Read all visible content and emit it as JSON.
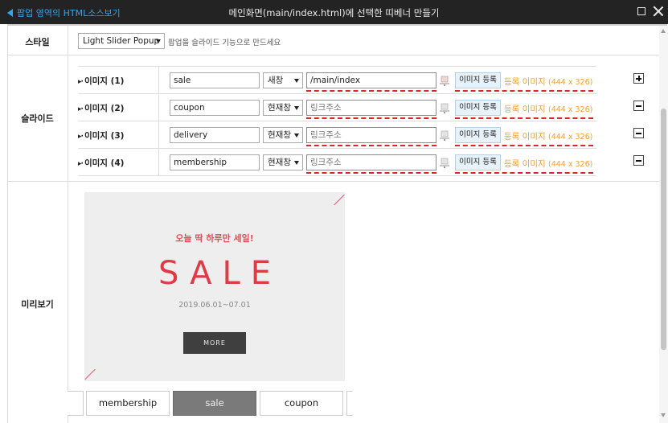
{
  "titlebar": {
    "back_label": "팝업 영역의 HTML소스보기",
    "title": "메인화면(main/index.html)에 선택한 띠베너 만들기"
  },
  "rows": {
    "style_label": "스타일",
    "slide_label": "슬라이드",
    "preview_label": "미리보기"
  },
  "style": {
    "selected": "Light Slider Popup",
    "hint": "팝업을 슬라이드 기능으로 만드세요"
  },
  "slides": [
    {
      "label": "이미지 (1)",
      "name": "sale",
      "target": "새창",
      "link": "/main/index",
      "link_placeholder": "",
      "image_button": "이미지 등록",
      "reg_text": "등록 이미지",
      "reg_size": "(444 x 326)",
      "action": "+"
    },
    {
      "label": "이미지 (2)",
      "name": "coupon",
      "target": "현재창",
      "link": "",
      "link_placeholder": "링크주소",
      "image_button": "이미지 등록",
      "reg_text": "등록 이미지",
      "reg_size": "(444 x 326)",
      "action": "-"
    },
    {
      "label": "이미지 (3)",
      "name": "delivery",
      "target": "현재창",
      "link": "",
      "link_placeholder": "링크주소",
      "image_button": "이미지 등록",
      "reg_text": "등록 이미지",
      "reg_size": "(444 x 326)",
      "action": "-"
    },
    {
      "label": "이미지 (4)",
      "name": "membership",
      "target": "현재창",
      "link": "",
      "link_placeholder": "링크주소",
      "image_button": "이미지 등록",
      "reg_text": "등록 이미지",
      "reg_size": "(444 x 326)",
      "action": "-"
    }
  ],
  "preview": {
    "headline": "오늘 딱 하루만 세일!",
    "big_text": "SALE",
    "dates": "2019.06.01~07.01",
    "more": "MORE",
    "thumbs": [
      {
        "label": "",
        "active": false
      },
      {
        "label": "membership",
        "active": false
      },
      {
        "label": "sale",
        "active": true
      },
      {
        "label": "coupon",
        "active": false
      },
      {
        "label": "",
        "active": false
      }
    ]
  },
  "colors": {
    "accent_link": "#2aa8f2",
    "underline": "#d9262b",
    "reg_text": "#f0a030",
    "sale_red": "#dd3b46"
  }
}
